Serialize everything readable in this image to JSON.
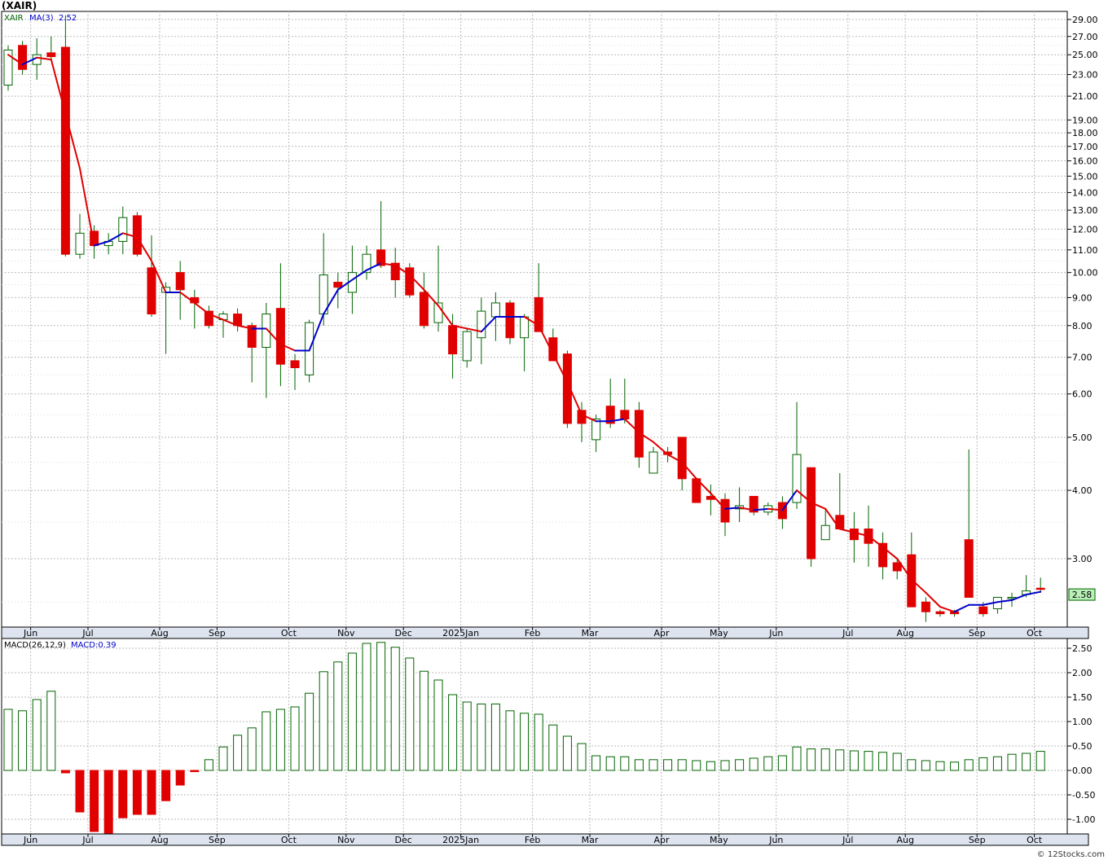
{
  "title": "(XAIR)",
  "watermark": "© 12Stocks.com",
  "price_panel": {
    "symbol": "XAIR",
    "ma_label": "MA(3)",
    "ma_value": "2.52",
    "last_price": "2.58",
    "y_ticks": [
      "29.00",
      "27.00",
      "25.00",
      "23.00",
      "21.00",
      "19.00",
      "18.00",
      "17.00",
      "16.00",
      "15.00",
      "14.00",
      "13.00",
      "12.00",
      "11.00",
      "10.00",
      "9.00",
      "8.00",
      "7.00",
      "6.00",
      "5.00",
      "4.00",
      "3.00"
    ],
    "x_labels": [
      "Jun",
      "Jul",
      "Aug",
      "Sep",
      "Oct",
      "Nov",
      "Dec",
      "2025Jan",
      "Feb",
      "Mar",
      "Apr",
      "May",
      "Jun",
      "Jul",
      "Aug",
      "Sep",
      "Oct"
    ]
  },
  "macd_panel": {
    "label": "MACD(26,12,9)",
    "value_label": "MACD:0.39",
    "y_ticks": [
      "2.50",
      "2.00",
      "1.50",
      "1.00",
      "0.50",
      "0.00",
      "-0.50",
      "-1.00"
    ],
    "x_labels": [
      "Jun",
      "Jul",
      "Aug",
      "Sep",
      "Oct",
      "Nov",
      "Dec",
      "2025Jan",
      "Feb",
      "Mar",
      "Apr",
      "May",
      "Jun",
      "Jul",
      "Aug",
      "Sep",
      "Oct"
    ]
  },
  "colors": {
    "up": "#006400",
    "down": "#e00000",
    "ma_up": "#0000cc",
    "ma_down": "#e00000",
    "last_box": "#b8f0b8"
  },
  "chart_data": [
    {
      "type": "candlestick",
      "title": "(XAIR)",
      "y_scale": "log",
      "ylim": [
        2.25,
        30
      ],
      "grid": true,
      "candles": [
        {
          "o": 22.0,
          "h": 26.0,
          "l": 21.5,
          "c": 25.5
        },
        {
          "o": 26.0,
          "h": 26.5,
          "l": 23.0,
          "c": 23.5
        },
        {
          "o": 24.0,
          "h": 26.8,
          "l": 22.5,
          "c": 25.0
        },
        {
          "o": 25.2,
          "h": 27.0,
          "l": 24.5,
          "c": 24.8
        },
        {
          "o": 25.8,
          "h": 29.5,
          "l": 10.7,
          "c": 10.8
        },
        {
          "o": 10.8,
          "h": 12.8,
          "l": 10.6,
          "c": 11.8
        },
        {
          "o": 11.9,
          "h": 12.2,
          "l": 10.6,
          "c": 11.2
        },
        {
          "o": 11.2,
          "h": 11.8,
          "l": 10.8,
          "c": 11.4
        },
        {
          "o": 11.4,
          "h": 13.2,
          "l": 10.8,
          "c": 12.6
        },
        {
          "o": 12.7,
          "h": 12.9,
          "l": 10.7,
          "c": 10.8
        },
        {
          "o": 10.2,
          "h": 11.7,
          "l": 8.3,
          "c": 8.4
        },
        {
          "o": 9.2,
          "h": 9.6,
          "l": 7.1,
          "c": 9.4
        },
        {
          "o": 10.0,
          "h": 10.5,
          "l": 8.2,
          "c": 9.3
        },
        {
          "o": 9.0,
          "h": 9.3,
          "l": 7.9,
          "c": 8.8
        },
        {
          "o": 8.5,
          "h": 8.7,
          "l": 7.9,
          "c": 8.0
        },
        {
          "o": 8.2,
          "h": 8.5,
          "l": 7.6,
          "c": 8.4
        },
        {
          "o": 8.4,
          "h": 8.6,
          "l": 7.8,
          "c": 8.0
        },
        {
          "o": 8.0,
          "h": 8.1,
          "l": 6.3,
          "c": 7.3
        },
        {
          "o": 7.3,
          "h": 8.8,
          "l": 5.9,
          "c": 8.4
        },
        {
          "o": 8.6,
          "h": 10.4,
          "l": 6.2,
          "c": 6.8
        },
        {
          "o": 6.9,
          "h": 7.1,
          "l": 6.1,
          "c": 6.7
        },
        {
          "o": 6.5,
          "h": 8.2,
          "l": 6.3,
          "c": 8.1
        },
        {
          "o": 8.4,
          "h": 11.8,
          "l": 8.0,
          "c": 9.9
        },
        {
          "o": 9.6,
          "h": 10.0,
          "l": 8.6,
          "c": 9.4
        },
        {
          "o": 9.2,
          "h": 11.2,
          "l": 8.4,
          "c": 10.0
        },
        {
          "o": 10.0,
          "h": 11.2,
          "l": 9.7,
          "c": 10.8
        },
        {
          "o": 11.0,
          "h": 13.5,
          "l": 10.2,
          "c": 10.3
        },
        {
          "o": 10.4,
          "h": 11.1,
          "l": 9.0,
          "c": 9.7
        },
        {
          "o": 10.2,
          "h": 10.4,
          "l": 9.0,
          "c": 9.1
        },
        {
          "o": 9.2,
          "h": 10.0,
          "l": 7.9,
          "c": 8.0
        },
        {
          "o": 8.1,
          "h": 11.2,
          "l": 7.8,
          "c": 8.8
        },
        {
          "o": 8.0,
          "h": 8.4,
          "l": 6.4,
          "c": 7.1
        },
        {
          "o": 6.9,
          "h": 7.9,
          "l": 6.7,
          "c": 7.8
        },
        {
          "o": 7.6,
          "h": 9.0,
          "l": 6.8,
          "c": 8.5
        },
        {
          "o": 8.3,
          "h": 9.2,
          "l": 7.5,
          "c": 8.8
        },
        {
          "o": 8.8,
          "h": 8.9,
          "l": 7.4,
          "c": 7.6
        },
        {
          "o": 7.6,
          "h": 8.4,
          "l": 6.6,
          "c": 8.3
        },
        {
          "o": 9.0,
          "h": 10.4,
          "l": 7.8,
          "c": 7.8
        },
        {
          "o": 7.6,
          "h": 7.9,
          "l": 6.9,
          "c": 6.9
        },
        {
          "o": 7.1,
          "h": 7.2,
          "l": 5.2,
          "c": 5.3
        },
        {
          "o": 5.6,
          "h": 5.8,
          "l": 4.9,
          "c": 5.3
        },
        {
          "o": 4.95,
          "h": 5.5,
          "l": 4.7,
          "c": 5.4
        },
        {
          "o": 5.7,
          "h": 6.4,
          "l": 5.2,
          "c": 5.3
        },
        {
          "o": 5.6,
          "h": 6.4,
          "l": 5.3,
          "c": 5.4
        },
        {
          "o": 5.6,
          "h": 5.8,
          "l": 4.4,
          "c": 4.6
        },
        {
          "o": 4.3,
          "h": 4.8,
          "l": 4.3,
          "c": 4.7
        },
        {
          "o": 4.7,
          "h": 4.8,
          "l": 4.5,
          "c": 4.65
        },
        {
          "o": 5.0,
          "h": 5.0,
          "l": 4.0,
          "c": 4.2
        },
        {
          "o": 4.2,
          "h": 4.2,
          "l": 3.8,
          "c": 3.8
        },
        {
          "o": 3.9,
          "h": 4.1,
          "l": 3.6,
          "c": 3.85
        },
        {
          "o": 3.85,
          "h": 3.95,
          "l": 3.3,
          "c": 3.5
        },
        {
          "o": 3.7,
          "h": 4.05,
          "l": 3.5,
          "c": 3.75
        },
        {
          "o": 3.9,
          "h": 3.9,
          "l": 3.6,
          "c": 3.65
        },
        {
          "o": 3.65,
          "h": 3.8,
          "l": 3.6,
          "c": 3.75
        },
        {
          "o": 3.8,
          "h": 3.9,
          "l": 3.4,
          "c": 3.55
        },
        {
          "o": 3.8,
          "h": 5.8,
          "l": 3.7,
          "c": 4.65
        },
        {
          "o": 4.4,
          "h": 4.4,
          "l": 2.9,
          "c": 3.0
        },
        {
          "o": 3.25,
          "h": 3.7,
          "l": 3.25,
          "c": 3.45
        },
        {
          "o": 3.6,
          "h": 4.3,
          "l": 3.4,
          "c": 3.4
        },
        {
          "o": 3.4,
          "h": 3.65,
          "l": 2.95,
          "c": 3.25
        },
        {
          "o": 3.4,
          "h": 3.75,
          "l": 2.9,
          "c": 3.2
        },
        {
          "o": 3.2,
          "h": 3.35,
          "l": 2.75,
          "c": 2.9
        },
        {
          "o": 2.95,
          "h": 3.0,
          "l": 2.75,
          "c": 2.85
        },
        {
          "o": 3.05,
          "h": 3.35,
          "l": 2.45,
          "c": 2.45
        },
        {
          "o": 2.5,
          "h": 2.55,
          "l": 2.3,
          "c": 2.4
        },
        {
          "o": 2.4,
          "h": 2.42,
          "l": 2.35,
          "c": 2.38
        },
        {
          "o": 2.4,
          "h": 2.42,
          "l": 2.35,
          "c": 2.38
        },
        {
          "o": 3.25,
          "h": 4.75,
          "l": 2.55,
          "c": 2.55
        },
        {
          "o": 2.45,
          "h": 2.5,
          "l": 2.35,
          "c": 2.38
        },
        {
          "o": 2.43,
          "h": 2.55,
          "l": 2.38,
          "c": 2.55
        },
        {
          "o": 2.55,
          "h": 2.6,
          "l": 2.45,
          "c": 2.55
        },
        {
          "o": 2.58,
          "h": 2.8,
          "l": 2.55,
          "c": 2.62
        },
        {
          "o": 2.65,
          "h": 2.77,
          "l": 2.6,
          "c": 2.64
        }
      ],
      "ma3": [
        25.0,
        24.0,
        24.7,
        24.5,
        19.5,
        15.5,
        11.2,
        11.4,
        11.8,
        11.6,
        10.5,
        9.2,
        9.2,
        8.8,
        8.4,
        8.2,
        8.0,
        7.9,
        7.9,
        7.4,
        7.2,
        7.2,
        8.4,
        9.3,
        9.7,
        10.1,
        10.4,
        10.3,
        9.9,
        9.3,
        8.7,
        8.0,
        7.9,
        7.8,
        8.3,
        8.3,
        8.3,
        8.0,
        7.1,
        6.3,
        5.5,
        5.35,
        5.35,
        5.4,
        5.1,
        4.9,
        4.65,
        4.5,
        4.2,
        3.95,
        3.7,
        3.72,
        3.68,
        3.7,
        3.68,
        4.0,
        3.8,
        3.7,
        3.4,
        3.35,
        3.3,
        3.15,
        3.0,
        2.75,
        2.6,
        2.45,
        2.4,
        2.47,
        2.47,
        2.5,
        2.52,
        2.58,
        2.61
      ],
      "last": 2.58
    },
    {
      "type": "bar",
      "title": "MACD(26,12,9)",
      "ylim": [
        -1.3,
        2.7
      ],
      "values": [
        1.25,
        1.22,
        1.45,
        1.62,
        -0.05,
        -0.85,
        -1.25,
        -1.3,
        -0.97,
        -0.9,
        -0.9,
        -0.62,
        -0.3,
        -0.02,
        0.22,
        0.48,
        0.72,
        0.87,
        1.2,
        1.25,
        1.3,
        1.58,
        2.02,
        2.22,
        2.4,
        2.6,
        2.62,
        2.52,
        2.3,
        2.03,
        1.85,
        1.55,
        1.4,
        1.36,
        1.36,
        1.22,
        1.17,
        1.15,
        0.93,
        0.7,
        0.55,
        0.3,
        0.28,
        0.28,
        0.22,
        0.22,
        0.22,
        0.22,
        0.2,
        0.18,
        0.2,
        0.22,
        0.25,
        0.28,
        0.3,
        0.48,
        0.44,
        0.44,
        0.42,
        0.4,
        0.39,
        0.37,
        0.35,
        0.22,
        0.2,
        0.18,
        0.17,
        0.22,
        0.26,
        0.28,
        0.33,
        0.35,
        0.39
      ]
    }
  ]
}
